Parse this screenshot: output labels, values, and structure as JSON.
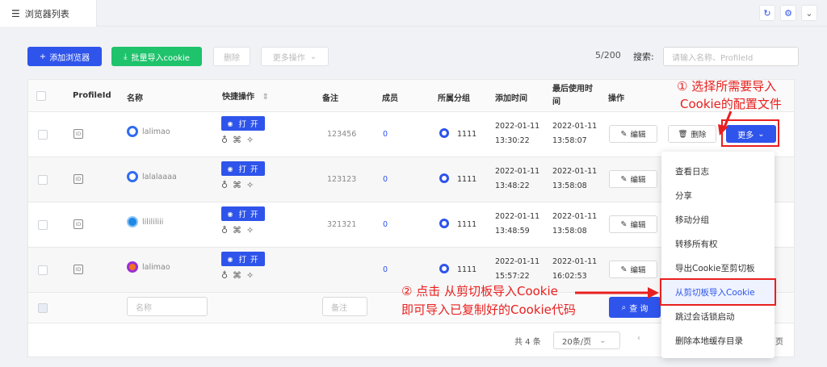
{
  "tab": {
    "title": "浏览器列表"
  },
  "toolbar": {
    "add_browser": "添加浏览器",
    "batch_import": "批量导入cookie",
    "delete": "删除",
    "more_ops": "更多操作",
    "count": "5/200",
    "search_label": "搜索:",
    "search_placeholder": "请输入名称、ProfileId"
  },
  "columns": [
    "ProfileId",
    "名称",
    "快捷操作",
    "备注",
    "成员",
    "所属分组",
    "添加时间",
    "最后使用时间",
    "操作"
  ],
  "rows": [
    {
      "name": "lalimao",
      "note": "123456",
      "member": "0",
      "group": "1111",
      "added_date": "2022-01-11",
      "added_time": "13:30:22",
      "used_date": "2022-01-11",
      "used_time": "13:58:07",
      "browser": "chrome"
    },
    {
      "name": "lalalaaaa",
      "note": "123123",
      "member": "0",
      "group": "1111",
      "added_date": "2022-01-11",
      "added_time": "13:48:22",
      "used_date": "2022-01-11",
      "used_time": "13:58:08",
      "browser": "chrome"
    },
    {
      "name": "lilililiii",
      "note": "321321",
      "member": "0",
      "group": "1111",
      "added_date": "2022-01-11",
      "added_time": "13:48:59",
      "used_date": "2022-01-11",
      "used_time": "13:58:08",
      "browser": "safari"
    },
    {
      "name": "lalimao",
      "note": "",
      "member": "0",
      "group": "1111",
      "added_date": "2022-01-11",
      "added_time": "15:57:22",
      "used_date": "2022-01-11",
      "used_time": "16:02:53",
      "browser": "firefox"
    }
  ],
  "row_actions": {
    "open": "打 开",
    "edit": "编辑",
    "delete": "删除",
    "more": "更多"
  },
  "filter": {
    "name_placeholder": "名称",
    "note_placeholder": "备注",
    "query": "查 询"
  },
  "more_menu": [
    "查看日志",
    "分享",
    "移动分组",
    "转移所有权",
    "导出Cookie至剪切板",
    "从剪切板导入Cookie",
    "跳过会话锁启动",
    "删除本地缓存目录"
  ],
  "pagination": {
    "total": "共 4 条",
    "page_size": "20条/页",
    "suffix": "页"
  },
  "annotations": {
    "note1_line1": "① 选择所需要导入",
    "note1_line2": "Cookie的配置文件",
    "note2_line1": "② 点击 从剪切板导入Cookie",
    "note2_line2": "即可导入已复制好的Cookie代码"
  },
  "colors": {
    "accent": "#2f54eb",
    "green": "#1ec36b",
    "annotation_red": "#e8201f"
  }
}
